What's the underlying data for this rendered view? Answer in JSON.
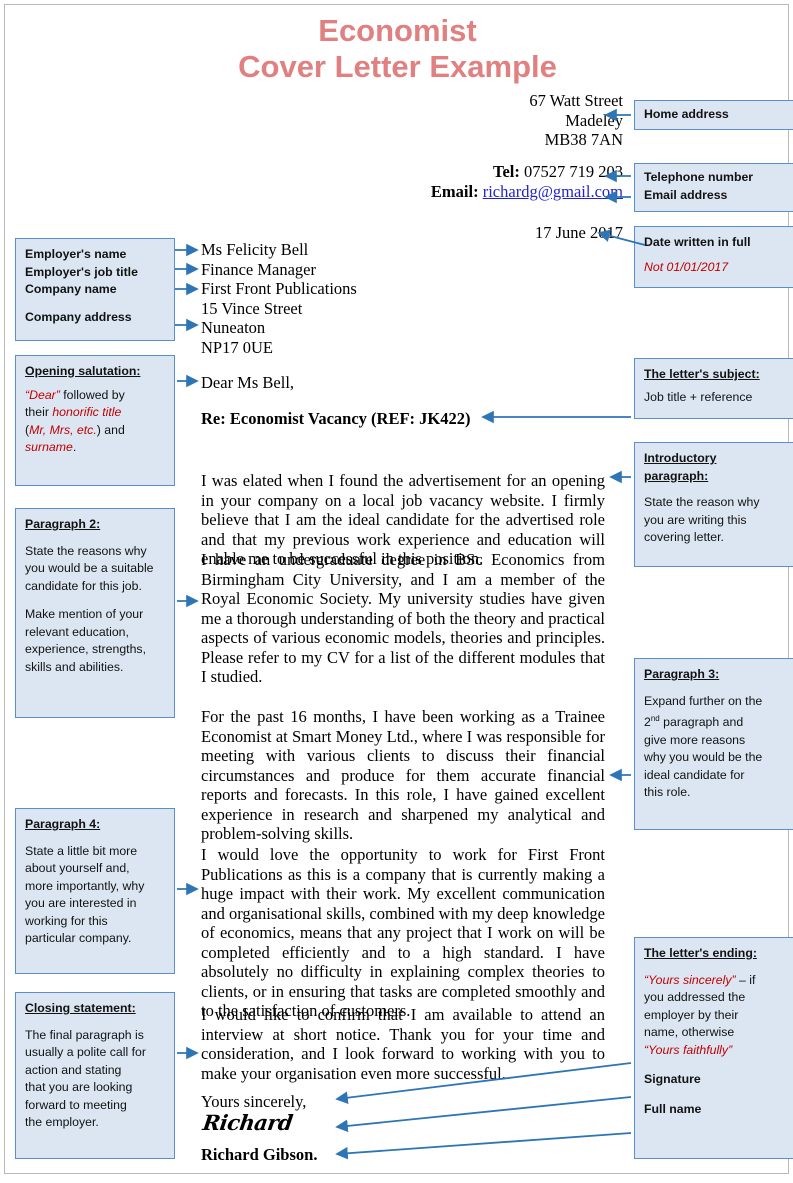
{
  "title": {
    "line1": "Economist",
    "line2": "Cover Letter Example",
    "color": "#e08080"
  },
  "theme": {
    "note_fill": "#dce6f2",
    "note_border": "#5b8fc9",
    "arrow_color": "#2e75b6",
    "red_accent": "#c00000",
    "link_color": "#2222cc"
  },
  "letter": {
    "home_address": [
      "67 Watt Street",
      "Madeley",
      "MB38 7AN"
    ],
    "tel_label": "Tel:",
    "tel_value": "07527 719 203",
    "email_label": "Email:",
    "email_value": "richardg@gmail.com",
    "date": "17 June 2017",
    "recipient": [
      "Ms Felicity Bell",
      "Finance Manager",
      "First Front Publications",
      "15 Vince Street",
      "Nuneaton",
      "NP17 0UE"
    ],
    "salutation": "Dear Ms Bell,",
    "subject": "Re: Economist Vacancy (REF: JK422)",
    "paragraphs": [
      "I was elated when I found the advertisement for an opening in your company on a local job vacancy website. I firmly believe that I am the ideal candidate for the advertised role and that my previous work experience and education will enable me to be successful in this position.",
      "I have an undergraduate degree in BSc Economics from Birmingham City University, and I am a member of the Royal Economic Society. My university studies have given me a thorough understanding of both the theory and practical aspects of various economic models, theories and principles.  Please refer to my CV for a list of the different modules that I studied.",
      "For the past 16 months, I have been working as a Trainee Economist at Smart Money Ltd., where I was responsible for meeting with various clients to discuss their financial circumstances and produce for them accurate financial reports and forecasts. In this role, I have gained excellent experience in research and sharpened my analytical and problem-solving skills.",
      "I would love the opportunity to work for First Front Publications as this is a company that is currently making a huge impact with their work. My excellent communication and organisational skills, combined with my deep knowledge of economics, means that any project that I work on will be completed efficiently and to a high standard. I have absolutely no difficulty in explaining complex theories to clients, or in ensuring that tasks are completed smoothly and to the satisfaction of customers.",
      "I would like to confirm that I am available to attend an interview at short notice. Thank you for your time and consideration, and I look forward to working with you to make your organisation even more successful."
    ],
    "sign_off": "Yours sincerely,",
    "signature": "Richard",
    "full_name": "Richard Gibson."
  },
  "notes": {
    "home_address": {
      "label": "Home address"
    },
    "contact": {
      "line1": "Telephone number",
      "line2": "Email address"
    },
    "date": {
      "heading": "Date written in full",
      "warning": "Not 01/01/2017"
    },
    "employer": {
      "l1": "Employer's name",
      "l2": "Employer's job title",
      "l3": "Company name",
      "l4": "Company address"
    },
    "salutation": {
      "heading": "Opening salutation:",
      "t1": "“Dear”",
      "t2": " followed by",
      "t3": "their ",
      "t4": "honorific title",
      "t5": "(",
      "t6": "Mr, Mrs, etc.",
      "t7": ") and",
      "t8": "surname",
      "t9": "."
    },
    "subject": {
      "heading": "The letter's subject:",
      "body": "Job title + reference"
    },
    "intro": {
      "heading1": "Introductory",
      "heading2": "paragraph:",
      "l1": "State the reason why",
      "l2": "you are writing this",
      "l3": "covering letter."
    },
    "para2": {
      "heading": "Paragraph 2:",
      "l1": "State the reasons why",
      "l2": "you would be a suitable",
      "l3": "candidate for this job.",
      "l4": "Make mention of your",
      "l5": "relevant education,",
      "l6": "experience, strengths,",
      "l7": "skills and abilities."
    },
    "para3": {
      "heading": "Paragraph 3:",
      "l1": "Expand further on the",
      "l2a": "2",
      "l2b": "nd",
      "l2c": " paragraph and",
      "l3": "give more reasons",
      "l4": "why you would be the",
      "l5": "ideal candidate for",
      "l6": "this role."
    },
    "para4": {
      "heading": "Paragraph 4:",
      "l1": "State a little bit more",
      "l2": "about yourself and,",
      "l3": "more importantly, why",
      "l4": "you are interested in",
      "l5": "working for this",
      "l6": "particular company."
    },
    "closing": {
      "heading": "Closing statement:",
      "l1": "The final paragraph is",
      "l2": "usually a polite call for",
      "l3": "action and stating",
      "l4": "that you are looking",
      "l5": "forward to meeting",
      "l6": "the employer."
    },
    "ending": {
      "heading": "The letter's ending:",
      "q1": "“Yours sincerely”",
      "t1": " – if",
      "l2": "you addressed the",
      "l3": "employer by their",
      "l4": "name, otherwise",
      "q2": "“Yours faithfully”",
      "signature_label": "Signature",
      "fullname_label": "Full name"
    }
  }
}
